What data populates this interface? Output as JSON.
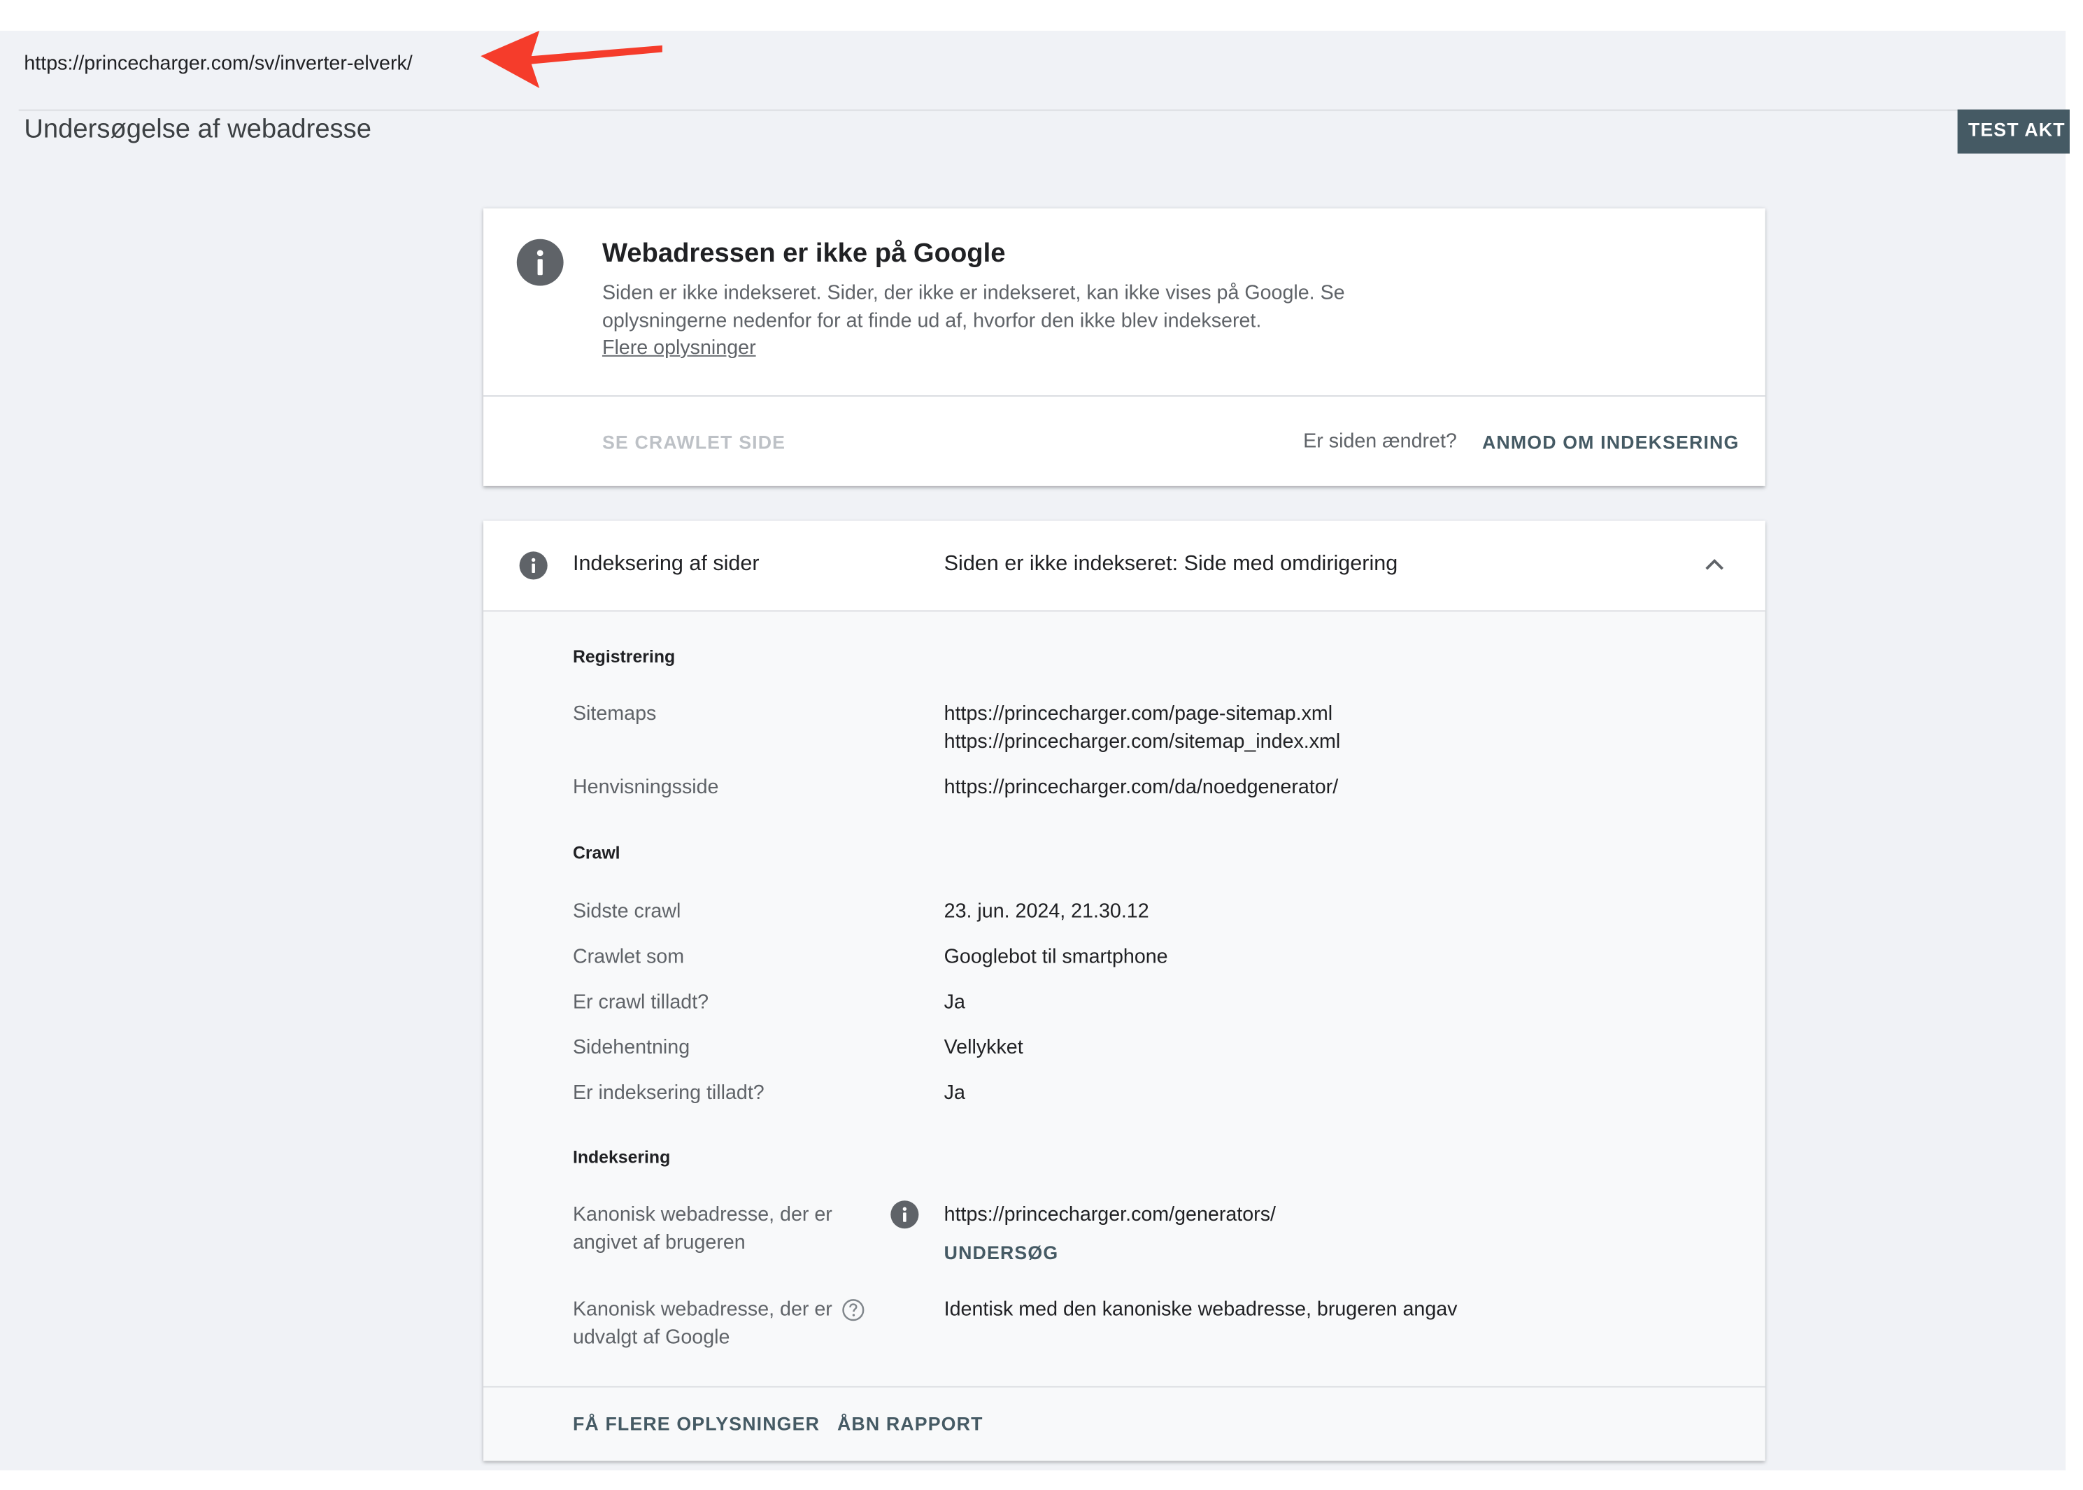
{
  "url_bar": {
    "url": "https://princecharger.com/sv/inverter-elverk/"
  },
  "annotation": {
    "arrow_color": "#f53c2b",
    "icon": "red-arrow-icon"
  },
  "header": {
    "title": "Undersøgelse af webadresse",
    "test_live_button": "TEST AKT"
  },
  "status_card": {
    "icon": "info-icon",
    "title": "Webadressen er ikke på Google",
    "description": "Siden er ikke indekseret. Sider, der ikke er indekseret, kan ikke vises på Google. Se oplysningerne nedenfor for at finde ud af, hvorfor den ikke blev indekseret.",
    "learn_more": "Flere oplysninger",
    "view_crawled": "SE CRAWLET SIDE",
    "changed_question": "Er siden ændret?",
    "request_indexing": "ANMOD OM INDEKSERING"
  },
  "indexing_card": {
    "label": "Indeksering af sider",
    "status": "Siden er ikke indekseret: Side med omdirigering",
    "sections": {
      "discovery": {
        "title": "Registrering",
        "sitemaps_label": "Sitemaps",
        "sitemaps": [
          "https://princecharger.com/page-sitemap.xml",
          "https://princecharger.com/sitemap_index.xml"
        ],
        "referring_label": "Henvisningsside",
        "referring_value": "https://princecharger.com/da/noedgenerator/"
      },
      "crawl": {
        "title": "Crawl",
        "last_crawl_label": "Sidste crawl",
        "last_crawl_value": "23. jun. 2024, 21.30.12",
        "crawled_as_label": "Crawlet som",
        "crawled_as_value": "Googlebot til smartphone",
        "crawl_allowed_label": "Er crawl tilladt?",
        "crawl_allowed_value": "Ja",
        "page_fetch_label": "Sidehentning",
        "page_fetch_value": "Vellykket",
        "indexing_allowed_label": "Er indeksering tilladt?",
        "indexing_allowed_value": "Ja"
      },
      "indexing": {
        "title": "Indeksering",
        "user_canonical_label": "Kanonisk webadresse, der er angivet af brugeren",
        "user_canonical_value": "https://princecharger.com/generators/",
        "inspect_button": "UNDERSØG",
        "google_canonical_label": "Kanonisk webadresse, der er udvalgt af Google",
        "google_canonical_value": "Identisk med den kanoniske webadresse, brugeren angav"
      }
    },
    "learn_more_button": "FÅ FLERE OPLYSNINGER",
    "open_report_button": "ÅBN RAPPORT"
  }
}
